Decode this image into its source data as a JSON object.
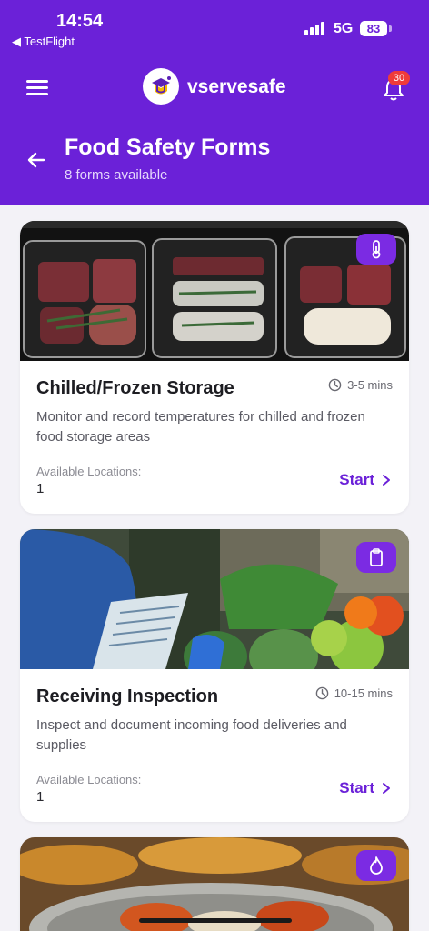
{
  "status_bar": {
    "time": "14:54",
    "back_app": "◀ TestFlight",
    "network": "5G",
    "battery": "83"
  },
  "app_bar": {
    "brand": "vservesafe",
    "notification_count": "30"
  },
  "page": {
    "title": "Food Safety Forms",
    "subtitle": "8 forms available"
  },
  "forms": [
    {
      "title": "Chilled/Frozen Storage",
      "duration": "3-5 mins",
      "description": "Monitor and record temperatures for chilled and frozen food storage areas",
      "locations_label": "Available Locations:",
      "locations_value": "1",
      "action": "Start",
      "icon": "thermometer-icon"
    },
    {
      "title": "Receiving Inspection",
      "duration": "10-15 mins",
      "description": "Inspect and document incoming food deliveries and supplies",
      "locations_label": "Available Locations:",
      "locations_value": "1",
      "action": "Start",
      "icon": "clipboard-icon"
    },
    {
      "icon": "flame-icon"
    }
  ],
  "colors": {
    "primary": "#6b21d8",
    "tag": "#7b2be3",
    "badge": "#ef3b3b",
    "background": "#f3f2f7"
  }
}
